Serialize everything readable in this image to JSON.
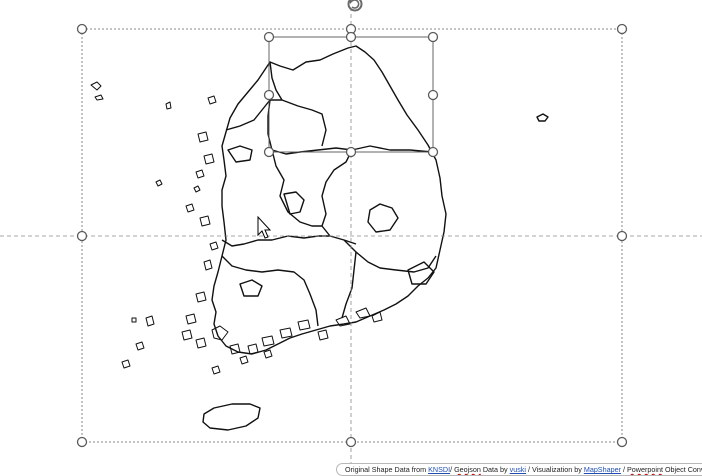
{
  "slide": {
    "content": "Map of South Korea provinces (vector outline, selected shape group)"
  },
  "credit": {
    "p1": "Original Shape Data from ",
    "l1": "KNSDI",
    "p2": "/ ",
    "d1": "Geojson",
    "p3": " Data by ",
    "l2": "vuski",
    "p4": " / Visualization  by ",
    "l3": "MapShaper",
    "p5": " / ",
    "d2": "Powerpoint",
    "p6": " Object Conversion and"
  },
  "colors": {
    "outline": "#111111",
    "selection_frame": "#8a8a8a",
    "handle_fill": "#ffffff",
    "handle_stroke": "#5a5a5a",
    "link": "#1f4fb4"
  },
  "icons": {
    "rotate_handle": "rotate-icon",
    "cursor": "arrow-pointer-icon"
  }
}
